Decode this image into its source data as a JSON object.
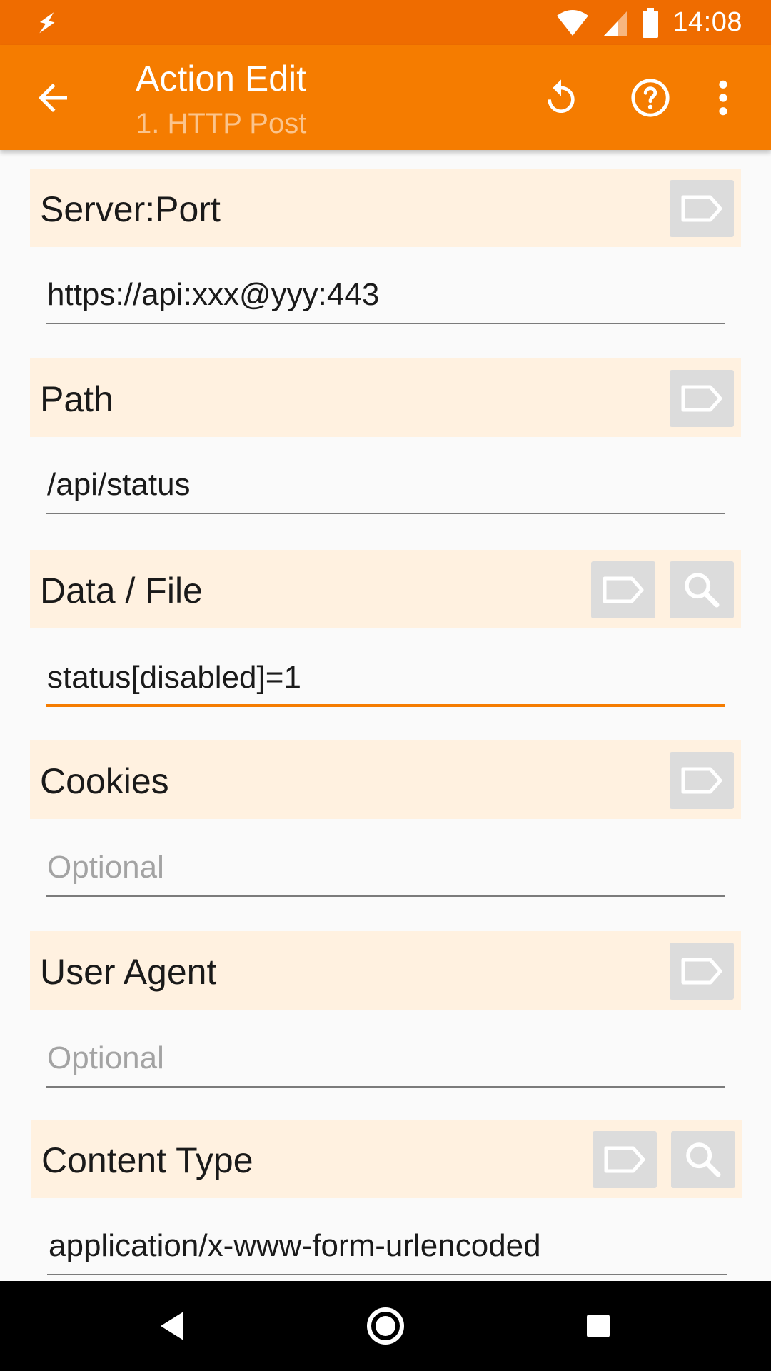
{
  "status_bar": {
    "time": "14:08",
    "left_icon": "flash-icon",
    "icons": [
      "wifi-icon",
      "signal-icon",
      "battery-icon"
    ],
    "background": "#ef6c00"
  },
  "toolbar": {
    "title": "Action Edit",
    "subtitle": "1. HTTP Post",
    "background": "#f57c00",
    "actions": [
      "undo-icon",
      "help-icon",
      "overflow-menu-icon"
    ]
  },
  "sections": [
    {
      "label": "Server:Port",
      "value": "https://api:xxx@yyy:443",
      "placeholder": ""
    },
    {
      "label": "Path",
      "value": "/api/status",
      "placeholder": ""
    },
    {
      "label": "Data / File",
      "value": "status[disabled]=1",
      "placeholder": ""
    },
    {
      "label": "Cookies",
      "value": "",
      "placeholder": "Optional"
    },
    {
      "label": "User Agent",
      "value": "",
      "placeholder": "Optional"
    },
    {
      "label": "Content Type",
      "value": "application/x-www-form-urlencoded",
      "placeholder": ""
    }
  ],
  "colors": {
    "section_header_bg": "#fff1e0",
    "accent": "#f57c00",
    "button_bg": "#dcdcdc"
  },
  "nav_bar": {
    "buttons": [
      "back-triangle-icon",
      "home-circle-icon",
      "recents-square-icon"
    ]
  }
}
